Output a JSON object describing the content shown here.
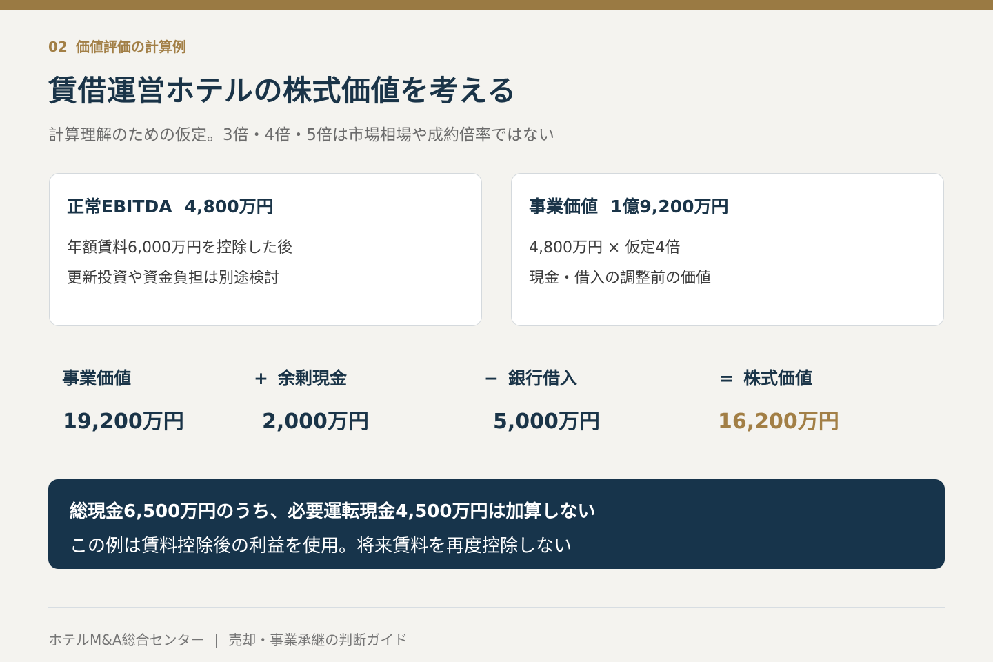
{
  "section": {
    "number": "02",
    "label": "価値評価の計算例"
  },
  "title": "賃借運営ホテルの株式価値を考える",
  "subtitle": "計算理解のための仮定。3倍・4倍・5倍は市場相場や成約倍率ではない",
  "cards": [
    {
      "heading": "正常EBITDA",
      "value": "4,800万円",
      "lines": [
        "年額賃料6,000万円を控除した後",
        "更新投資や資金負担は別途検討"
      ]
    },
    {
      "heading": "事業価値",
      "value": "1億9,200万円",
      "lines": [
        "4,800万円 × 仮定4倍",
        "現金・借入の調整前の価値"
      ]
    }
  ],
  "calculation": [
    {
      "operator": "",
      "label": "事業価値",
      "value": "19,200万円"
    },
    {
      "operator": "+",
      "label": "余剰現金",
      "value": "2,000万円"
    },
    {
      "operator": "−",
      "label": "銀行借入",
      "value": "5,000万円"
    },
    {
      "operator": "=",
      "label": "株式価値",
      "value": "16,200万円"
    }
  ],
  "note": {
    "headline": "総現金6,500万円のうち、必要運転現金4,500万円は加算しない",
    "body": "この例は賃料控除後の利益を使用。将来賃料を再度控除しない"
  },
  "footer": {
    "organization": "ホテルM&A総合センター",
    "separator": "|",
    "guide": "売却・事業承継の判断ガイド"
  },
  "colors": {
    "accent": "#9a7a43",
    "navy": "#17344b",
    "background": "#f4f3ef"
  }
}
